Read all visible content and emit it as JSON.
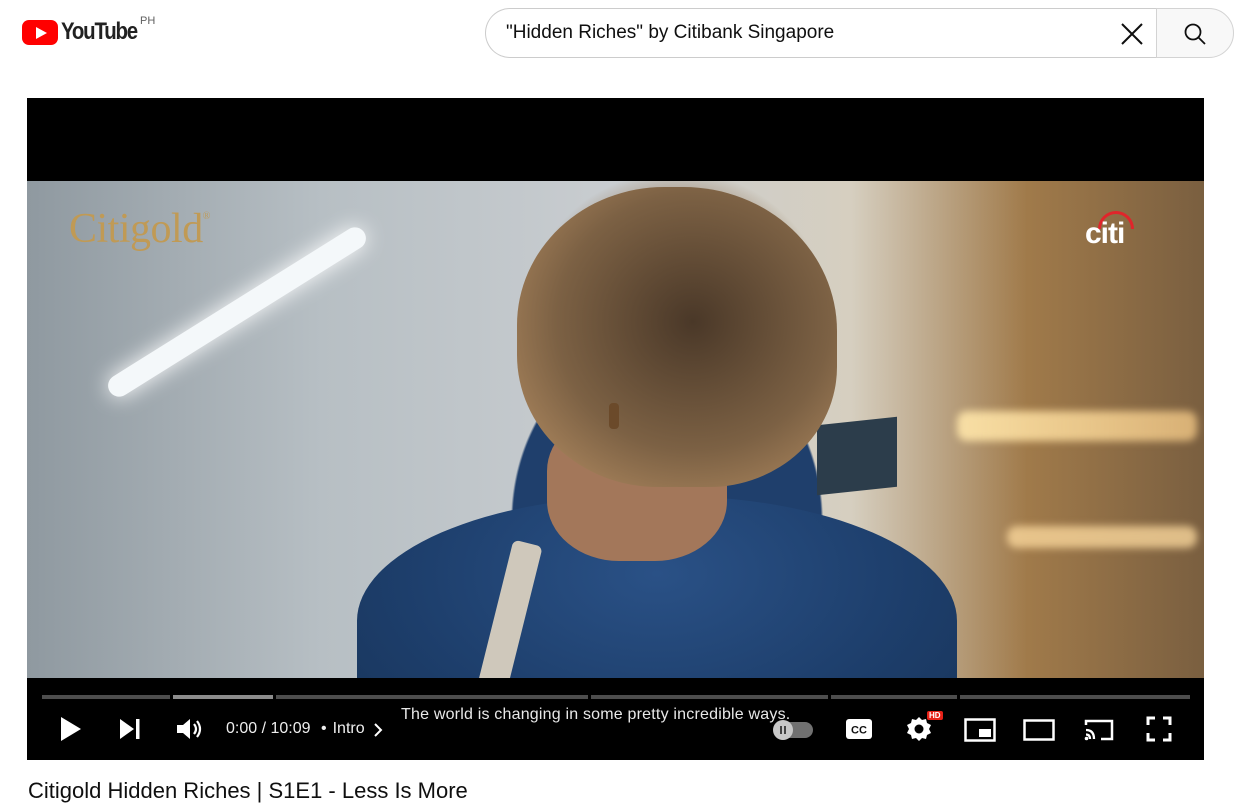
{
  "header": {
    "logo_text": "YouTube",
    "country_code": "PH",
    "search": {
      "value": "\"Hidden Riches\" by Citibank Singapore",
      "placeholder": "Search"
    }
  },
  "player": {
    "overlay": {
      "brand_left": "Citigold",
      "brand_left_mark": "®",
      "brand_right": "citi"
    },
    "caption": "The world is changing in some pretty incredible ways.",
    "time_display": "0:00 / 10:09",
    "chapter_separator": "•",
    "chapter_label": "Intro",
    "progress_played": 0,
    "hd_badge": "HD",
    "cc_label": "CC",
    "icons": [
      "play-icon",
      "next-icon",
      "volume-icon",
      "chevron-right-icon",
      "autoplay-toggle",
      "subtitles-icon",
      "settings-icon",
      "miniplayer-icon",
      "theater-mode-icon",
      "cast-icon",
      "fullscreen-icon"
    ],
    "accent_color": "#ff0000"
  },
  "video": {
    "title": "Citigold Hidden Riches | S1E1 - Less Is More"
  }
}
